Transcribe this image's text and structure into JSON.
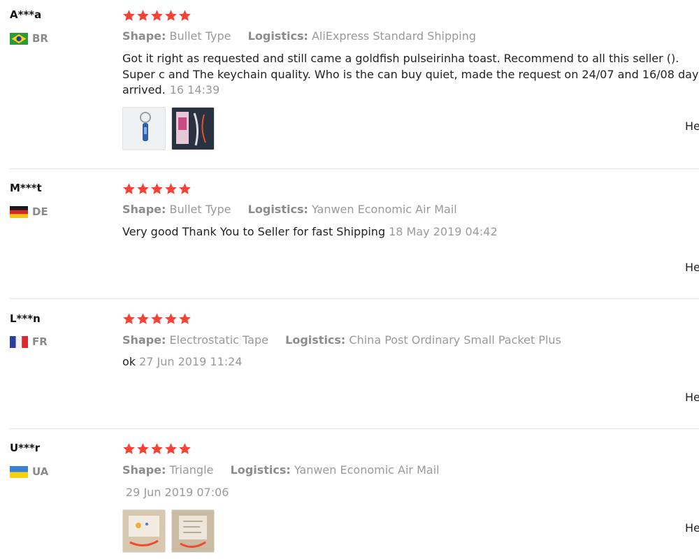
{
  "colors": {
    "star": "#f44336",
    "meta_text": "#999999",
    "divider": "#e6e6e6"
  },
  "labels": {
    "shape": "Shape:",
    "logistics": "Logistics:"
  },
  "reviews": [
    {
      "user": "A***a",
      "country": "BR",
      "flag_icon": "brazil-flag-icon",
      "rating": 5,
      "shape": "Bullet Type",
      "logistics": "AliExpress Standard Shipping",
      "text": "Got it right as requested and still came a goldfish pulseirinha toast. Recommend to all this seller (). Super c and The keychain quality. Who is the can buy quiet, made the request on 24/07 and 16/08 day arrived.",
      "date": "16 14:39",
      "helpful": "He"
    },
    {
      "user": "M***t",
      "country": "DE",
      "flag_icon": "germany-flag-icon",
      "rating": 5,
      "shape": "Bullet Type",
      "logistics": "Yanwen Economic Air Mail",
      "text": "Very good Thank You to Seller for fast Shipping",
      "date": "18 May 2019 04:42",
      "helpful": "He"
    },
    {
      "user": "L***n",
      "country": "FR",
      "flag_icon": "france-flag-icon",
      "rating": 5,
      "shape": "Electrostatic Tape",
      "logistics": "China Post Ordinary Small Packet Plus",
      "text": "ok",
      "date": "27 Jun 2019 11:24",
      "helpful": "He"
    },
    {
      "user": "U***r",
      "country": "UA",
      "flag_icon": "ukraine-flag-icon",
      "rating": 5,
      "shape": "Triangle",
      "logistics": "Yanwen Economic Air Mail",
      "text": "",
      "date": "29 Jun 2019 07:06",
      "helpful": "He"
    }
  ]
}
